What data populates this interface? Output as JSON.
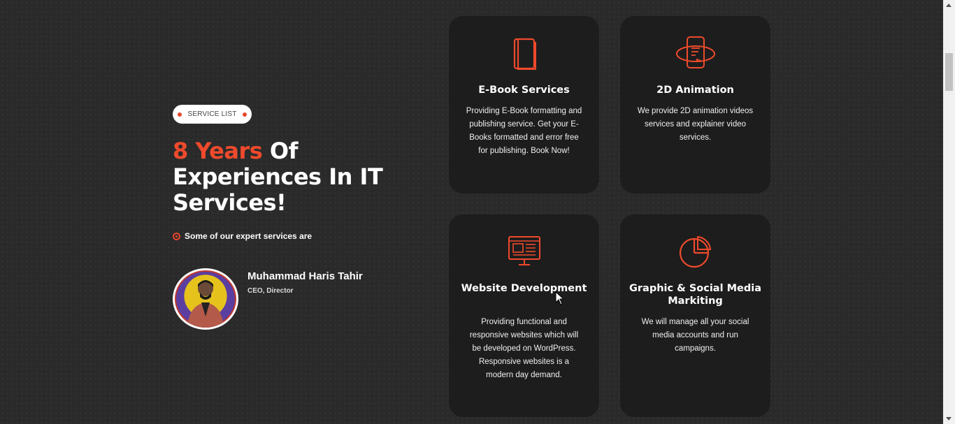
{
  "colors": {
    "accent": "#ef4a2c",
    "card_bg": "#1d1d1d",
    "page_bg": "#2a2a2a"
  },
  "left": {
    "badge_label": "SERVICE LIST",
    "headline_accent": "8 Years",
    "headline_rest": " Of Experiences In IT Services!",
    "sub_label": "Some of our expert services are",
    "person": {
      "name": "Muhammad Haris Tahir",
      "role": "CEO, Director"
    }
  },
  "cards": [
    {
      "title": "E-Book Services",
      "icon": "book-icon",
      "text": "Providing E-Book formatting and publishing service. Get your E-Books formatted and error free for publishing. Book Now!"
    },
    {
      "title": "2D Animation",
      "icon": "phone-rotate-icon",
      "text": "We provide 2D animation videos services and explainer video services."
    },
    {
      "title": "Website Development",
      "icon": "monitor-web-icon",
      "text": "Providing functional and responsive websites which will be developed on WordPress. Responsive websites is a modern day demand."
    },
    {
      "title": "Graphic & Social Media Markiting",
      "icon": "pie-chart-icon",
      "text": "We will manage all your social media accounts and run campaigns."
    }
  ]
}
